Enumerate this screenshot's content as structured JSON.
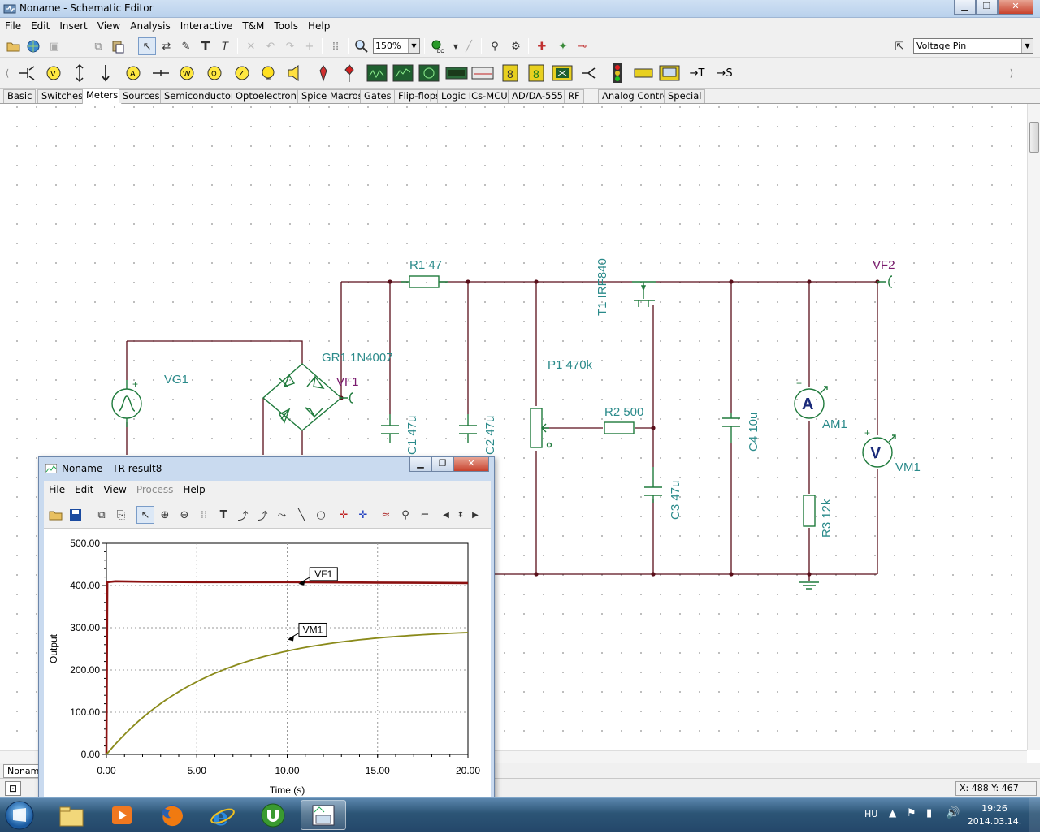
{
  "window": {
    "title": "Noname - Schematic Editor"
  },
  "menu": [
    "File",
    "Edit",
    "Insert",
    "View",
    "Analysis",
    "Interactive",
    "T&M",
    "Tools",
    "Help"
  ],
  "toolbar": {
    "zoom": "150%",
    "pin_type": "Voltage Pin"
  },
  "tabs": [
    "Basic",
    "Switches",
    "Meters",
    "Sources",
    "Semiconductors",
    "Optoelectronic",
    "Spice Macros",
    "Gates",
    "Flip-flops",
    "Logic ICs-MCUs",
    "AD/DA-555",
    "RF",
    "Analog Control",
    "Special"
  ],
  "active_tab": "Meters",
  "schematic": {
    "labels": {
      "r1": "R1 47",
      "t1": "T1 IRF840",
      "vf2": "VF2",
      "gr1": "GR1 1N4007",
      "vg1": "VG1",
      "vf1": "VF1",
      "p1": "P1 470k",
      "r2": "R2 500",
      "c1": "C1 47u",
      "c2": "C2 47u",
      "c3": "C3 47u",
      "c4": "C4 10u",
      "am1": "AM1",
      "vm1": "VM1",
      "r3": "R3 12k",
      "am_symbol": "A",
      "vm_symbol": "V",
      "plus": "+"
    }
  },
  "doc_tab": "Noname",
  "status": {
    "coords": "X: 488 Y: 467"
  },
  "result_window": {
    "title": "Noname - TR result8",
    "menu": [
      "File",
      "Edit",
      "View",
      "Process",
      "Help"
    ],
    "disabled_menu": "Process"
  },
  "chart_data": {
    "type": "line",
    "title": "",
    "xlabel": "Time (s)",
    "ylabel": "Output",
    "xlim": [
      0,
      20
    ],
    "ylim": [
      0,
      500
    ],
    "x_ticks": [
      "0.00",
      "5.00",
      "10.00",
      "15.00",
      "20.00"
    ],
    "y_ticks": [
      "0.00",
      "100.00",
      "200.00",
      "300.00",
      "400.00",
      "500.00"
    ],
    "grid": true,
    "series": [
      {
        "name": "VF1",
        "color": "#8b1010",
        "x": [
          0,
          0.05,
          0.5,
          2,
          5,
          10,
          15,
          20
        ],
        "y": [
          0,
          408,
          410,
          409,
          408,
          408,
          407,
          406
        ]
      },
      {
        "name": "VM1",
        "color": "#8a8a1a",
        "x": [
          0,
          1,
          2,
          3,
          4,
          5,
          6,
          8,
          10,
          12,
          14,
          16,
          18,
          20
        ],
        "y": [
          0,
          56,
          101,
          138,
          168,
          192,
          212,
          240,
          262,
          277,
          286,
          291,
          294,
          296
        ]
      }
    ],
    "annotations": [
      {
        "text": "VF1",
        "x": 10.8,
        "y": 408
      },
      {
        "text": "VM1",
        "x": 10.2,
        "y": 276
      }
    ]
  },
  "taskbar": {
    "apps": [
      "explorer",
      "media-player",
      "firefox",
      "internet-explorer",
      "utorrent",
      "tina"
    ],
    "language": "HU",
    "time": "19:26",
    "date": "2014.03.14."
  }
}
